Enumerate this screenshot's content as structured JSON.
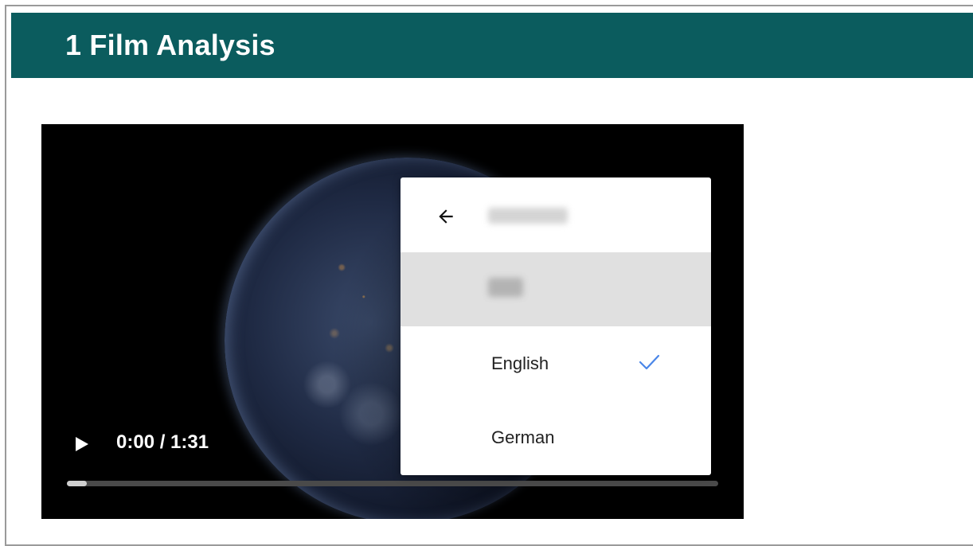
{
  "header": {
    "title": "1 Film Analysis"
  },
  "player": {
    "time_display": "0:00 / 1:31",
    "progress": 0.03,
    "play_icon": "play-icon"
  },
  "language_menu": {
    "back_icon": "arrow-left-icon",
    "options": [
      {
        "label": "English",
        "selected": true
      },
      {
        "label": "German",
        "selected": false
      }
    ],
    "check_icon": "check-icon"
  },
  "colors": {
    "header_bg": "#0b5c5e",
    "check_accent": "#4a86e8"
  }
}
